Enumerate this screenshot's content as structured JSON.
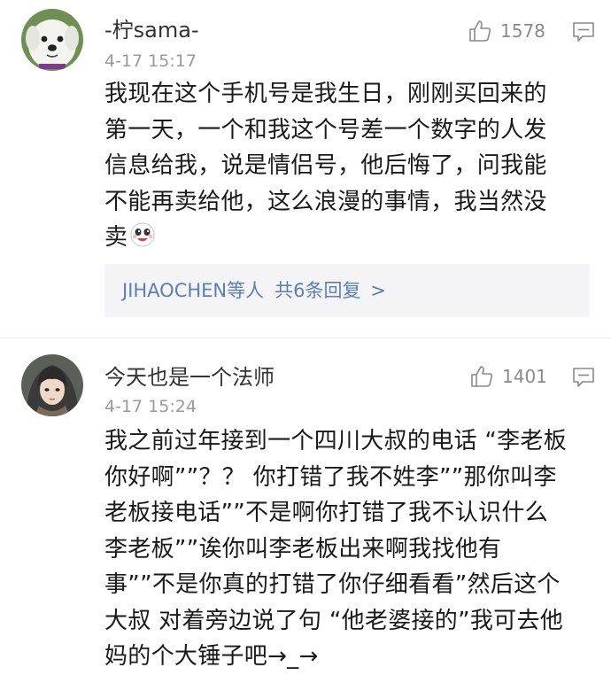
{
  "comments": [
    {
      "username": "-柠sama-",
      "timestamp": "4-17 15:17",
      "likes": "1578",
      "avatar_icon": "dog-avatar",
      "lines": [
        "我现在这个手机号是我生日，刚刚买回来的",
        "第一天，一个和我这个号差一个数字的人发",
        "信息给我，说是情侣号，他后悔了，问我能",
        "不能再卖给他，这么浪漫的事情，我当然没",
        "卖"
      ],
      "emoji": "laughing-emoji",
      "replies": {
        "who": "JIHAOCHEN等人",
        "count_label": "共6条回复",
        "chevron": ">"
      }
    },
    {
      "username": "今天也是一个法师",
      "timestamp": "4-17 15:24",
      "likes": "1401",
      "avatar_icon": "anime-girl-avatar",
      "lines": [
        "我之前过年接到一个四川大叔的电话 “李老板",
        "你好啊””？？ 你打错了我不姓李””那你叫李",
        "老板接电话””不是啊你打错了我不认识什么",
        "李老板””诶你叫李老板出来啊我找他有",
        "事””不是你真的打错了你仔细看看”然后这个",
        "大叔 对着旁边说了句 “他老婆接的”我可去他",
        "妈的个大锤子吧→_→"
      ]
    }
  ],
  "colors": {
    "link": "#5b7fb5",
    "meta": "#9a9a9a",
    "reply_bg": "#f4f4f6"
  }
}
